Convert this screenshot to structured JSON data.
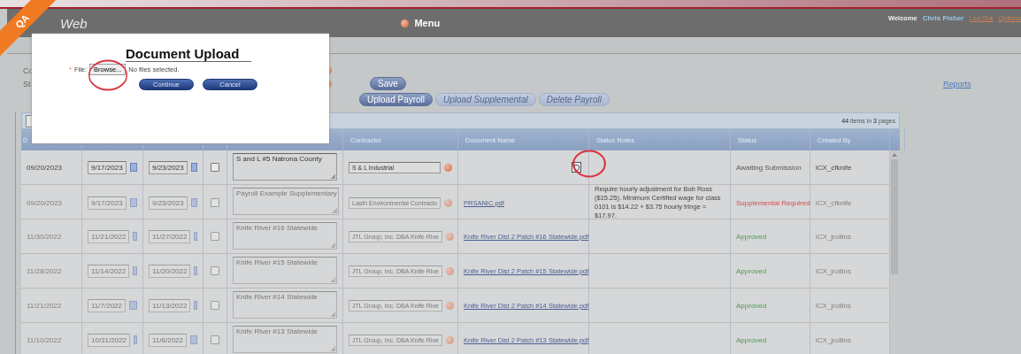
{
  "badge": "QA",
  "header": {
    "logo": "Web",
    "menu": "Menu",
    "welcome": "Welcome",
    "user": "Chris Fisher",
    "links": [
      "Log Out",
      "Options"
    ]
  },
  "form": {
    "labels": [
      "Co",
      "St"
    ],
    "save": "Save",
    "reports": "Reports"
  },
  "actions": [
    {
      "label": "Upload Payroll",
      "disabled": false
    },
    {
      "label": "Upload Supplemental",
      "disabled": true
    },
    {
      "label": "Delete Payroll",
      "disabled": true
    }
  ],
  "grid": {
    "pager": {
      "count": "44",
      "mid": "items in",
      "pages": "3",
      "tail": "pages"
    },
    "columns": [
      "D",
      "",
      "",
      "",
      "",
      "Contractor",
      "Document Name",
      "Status Notes",
      "Status",
      "Created By"
    ],
    "rows": [
      {
        "date": "09/20/2023",
        "start": "9/17/2023",
        "end": "9/23/2023",
        "checked": false,
        "disabled": false,
        "description": "S and L #5 Natrona County",
        "contractor": "S & L Industrial",
        "document": null,
        "notes": "",
        "status": "Awaiting Submission",
        "kind": "waiting",
        "created_by": "iCX_cfknife"
      },
      {
        "date": "09/20/2023",
        "start": "9/17/2023",
        "end": "9/23/2023",
        "checked": false,
        "disabled": true,
        "description": "Payroll Example Supplementary",
        "contractor": "Lasth Environmental Contracto",
        "document": "PRSANIC.pdf",
        "notes": "Require hourly adjustment for Bob Ross ($15.25). Minimum Certified wage for class 0101 is $14.22 + $3.75 hourly fringe = $17.97.",
        "status": "Supplemental Required",
        "kind": "required",
        "created_by": "iCX_cfknife"
      },
      {
        "date": "11/30/2022",
        "start": "11/21/2022",
        "end": "11/27/2022",
        "checked": false,
        "disabled": true,
        "description": "Knife River #16 Statewide",
        "contractor": "JTL Group, Inc. DBA Knife Rive",
        "document": "Knife River Dist 2 Patch #16 Statewide.pdf",
        "notes": "",
        "status": "Approved",
        "kind": "approved",
        "created_by": "iCX_jrollins"
      },
      {
        "date": "11/28/2022",
        "start": "11/14/2022",
        "end": "11/20/2022",
        "checked": false,
        "disabled": true,
        "description": "Knife River #15 Statewide",
        "contractor": "JTL Group, Inc. DBA Knife Rive",
        "document": "Knife River Dist 2 Patch #15 Statewide.pdf",
        "notes": "",
        "status": "Approved",
        "kind": "approved",
        "created_by": "iCX_jrollins"
      },
      {
        "date": "11/21/2022",
        "start": "11/7/2022",
        "end": "11/13/2022",
        "checked": false,
        "disabled": true,
        "description": "Knife River #14 Statewide",
        "contractor": "JTL Group, Inc. DBA Knife Rive",
        "document": "Knife River Dist 2 Patch #14 Statewide.pdf",
        "notes": "",
        "status": "Approved",
        "kind": "approved",
        "created_by": "iCX_jrollins"
      },
      {
        "date": "11/10/2022",
        "start": "10/31/2022",
        "end": "11/6/2022",
        "checked": false,
        "disabled": true,
        "description": "Knife River #13 Statewide",
        "contractor": "JTL Group, Inc. DBA Knife Rive",
        "document": "Knife River Dist 2 Patch #13 Statewide.pdf",
        "notes": "",
        "status": "Approved",
        "kind": "approved",
        "created_by": "iCX_jrollins"
      }
    ]
  },
  "dialog": {
    "title": "Document Upload",
    "required": "*",
    "file_label": "File:",
    "browse": "Browse...",
    "file_status": "No files selected.",
    "buttons": [
      "Continue",
      "Cancel"
    ]
  }
}
